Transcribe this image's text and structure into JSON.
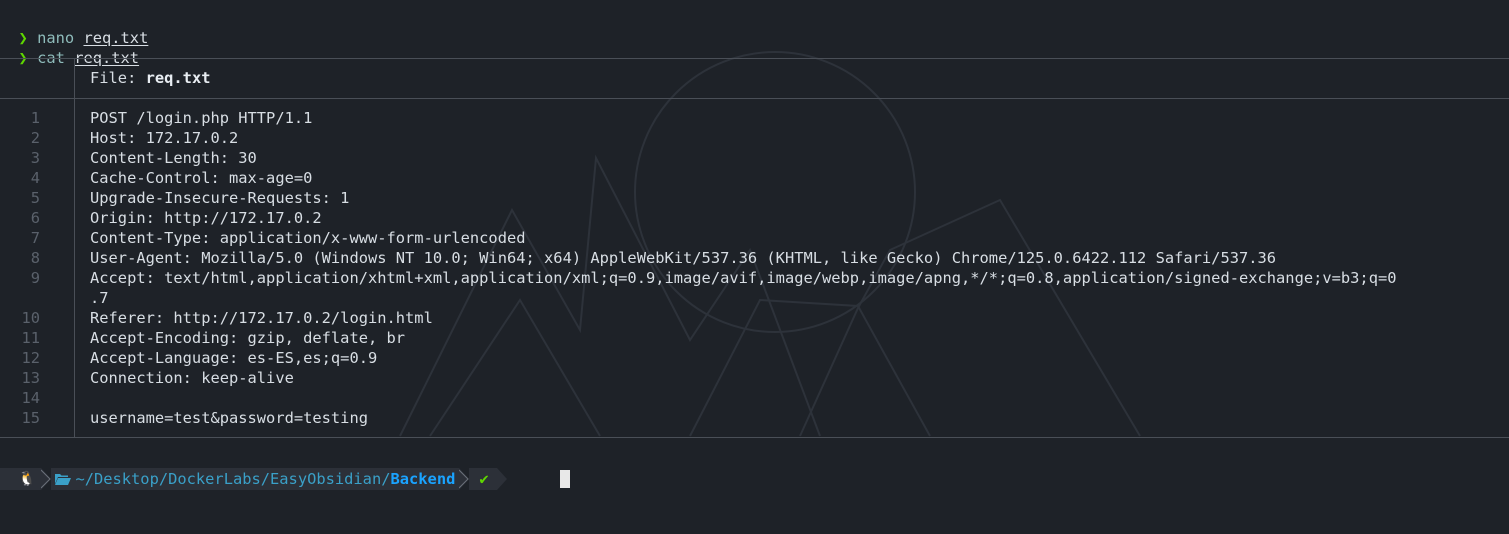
{
  "history": [
    {
      "arrow": "❯",
      "command": "nano",
      "argument": "req.txt"
    },
    {
      "arrow": "❯",
      "command": "cat",
      "argument": "req.txt"
    }
  ],
  "file_view": {
    "label": "File: ",
    "filename": "req.txt",
    "lines": [
      {
        "n": "1",
        "text": "POST /login.php HTTP/1.1"
      },
      {
        "n": "2",
        "text": "Host: 172.17.0.2"
      },
      {
        "n": "3",
        "text": "Content-Length: 30"
      },
      {
        "n": "4",
        "text": "Cache-Control: max-age=0"
      },
      {
        "n": "5",
        "text": "Upgrade-Insecure-Requests: 1"
      },
      {
        "n": "6",
        "text": "Origin: http://172.17.0.2"
      },
      {
        "n": "7",
        "text": "Content-Type: application/x-www-form-urlencoded"
      },
      {
        "n": "8",
        "text": "User-Agent: Mozilla/5.0 (Windows NT 10.0; Win64; x64) AppleWebKit/537.36 (KHTML, like Gecko) Chrome/125.0.6422.112 Safari/537.36"
      },
      {
        "n": "9",
        "text": "Accept: text/html,application/xhtml+xml,application/xml;q=0.9,image/avif,image/webp,image/apng,*/*;q=0.8,application/signed-exchange;v=b3;q=0"
      },
      {
        "n": "",
        "text": ".7"
      },
      {
        "n": "10",
        "text": "Referer: http://172.17.0.2/login.html"
      },
      {
        "n": "11",
        "text": "Accept-Encoding: gzip, deflate, br"
      },
      {
        "n": "12",
        "text": "Accept-Language: es-ES,es;q=0.9"
      },
      {
        "n": "13",
        "text": "Connection: keep-alive"
      },
      {
        "n": "14",
        "text": ""
      },
      {
        "n": "15",
        "text": "username=test&password=testing"
      }
    ]
  },
  "prompt": {
    "os_icon": "linux-tux-icon",
    "folder_icon": "folder-open-icon",
    "path_prefix": "~/Desktop/DockerLabs/EasyObsidian/",
    "path_last": "Backend",
    "status": "✔",
    "os_glyph": "🐧"
  },
  "colors": {
    "background": "#1e2228",
    "text": "#d8dee4",
    "prompt_arrow": "#5fd700",
    "command": "#8fbcbb",
    "line_number": "#5a616b",
    "path": "#3aa0c8",
    "path_last": "#1aa3ff",
    "status_ok": "#5fd700"
  }
}
